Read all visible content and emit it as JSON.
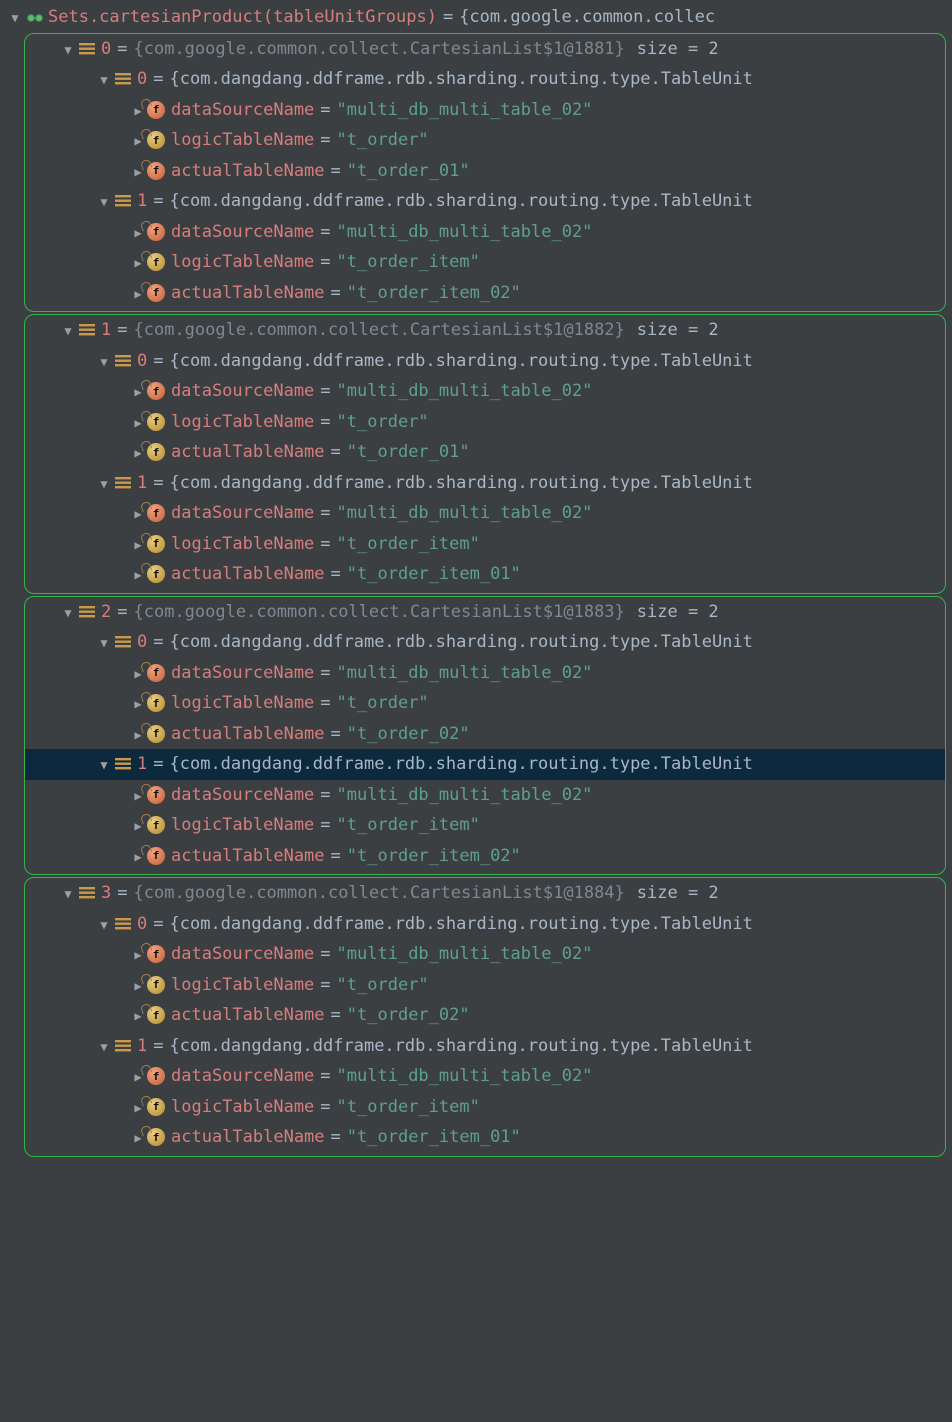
{
  "root": {
    "label": "Sets.cartesianProduct(tableUnitGroups)",
    "eq": "=",
    "value": "{com.google.common.collec"
  },
  "groups": [
    {
      "idx": "0",
      "brace": "{com.google.common.collect.CartesianList$1@1881}",
      "sizelabel": "size = 2",
      "units": [
        {
          "idx": "0",
          "brace": "{com.dangdang.ddframe.rdb.sharding.routing.type.TableUnit",
          "fields": [
            {
              "name": "dataSourceName",
              "val": "\"multi_db_multi_table_02\"",
              "color": "red"
            },
            {
              "name": "logicTableName",
              "val": "\"t_order\"",
              "color": "yel"
            },
            {
              "name": "actualTableName",
              "val": "\"t_order_01\"",
              "color": "red"
            }
          ]
        },
        {
          "idx": "1",
          "brace": "{com.dangdang.ddframe.rdb.sharding.routing.type.TableUnit",
          "fields": [
            {
              "name": "dataSourceName",
              "val": "\"multi_db_multi_table_02\"",
              "color": "red"
            },
            {
              "name": "logicTableName",
              "val": "\"t_order_item\"",
              "color": "yel"
            },
            {
              "name": "actualTableName",
              "val": "\"t_order_item_02\"",
              "color": "red"
            }
          ]
        }
      ]
    },
    {
      "idx": "1",
      "brace": "{com.google.common.collect.CartesianList$1@1882}",
      "sizelabel": "size = 2",
      "units": [
        {
          "idx": "0",
          "brace": "{com.dangdang.ddframe.rdb.sharding.routing.type.TableUnit",
          "fields": [
            {
              "name": "dataSourceName",
              "val": "\"multi_db_multi_table_02\"",
              "color": "red"
            },
            {
              "name": "logicTableName",
              "val": "\"t_order\"",
              "color": "yel"
            },
            {
              "name": "actualTableName",
              "val": "\"t_order_01\"",
              "color": "yel"
            }
          ]
        },
        {
          "idx": "1",
          "brace": "{com.dangdang.ddframe.rdb.sharding.routing.type.TableUnit",
          "fields": [
            {
              "name": "dataSourceName",
              "val": "\"multi_db_multi_table_02\"",
              "color": "red"
            },
            {
              "name": "logicTableName",
              "val": "\"t_order_item\"",
              "color": "yel"
            },
            {
              "name": "actualTableName",
              "val": "\"t_order_item_01\"",
              "color": "yel"
            }
          ]
        }
      ]
    },
    {
      "idx": "2",
      "brace": "{com.google.common.collect.CartesianList$1@1883}",
      "sizelabel": "size = 2",
      "units": [
        {
          "idx": "0",
          "brace": "{com.dangdang.ddframe.rdb.sharding.routing.type.TableUnit",
          "fields": [
            {
              "name": "dataSourceName",
              "val": "\"multi_db_multi_table_02\"",
              "color": "red"
            },
            {
              "name": "logicTableName",
              "val": "\"t_order\"",
              "color": "yel"
            },
            {
              "name": "actualTableName",
              "val": "\"t_order_02\"",
              "color": "yel"
            }
          ]
        },
        {
          "idx": "1",
          "selected": true,
          "brace": "{com.dangdang.ddframe.rdb.sharding.routing.type.TableUnit",
          "fields": [
            {
              "name": "dataSourceName",
              "val": "\"multi_db_multi_table_02\"",
              "color": "red"
            },
            {
              "name": "logicTableName",
              "val": "\"t_order_item\"",
              "color": "yel"
            },
            {
              "name": "actualTableName",
              "val": "\"t_order_item_02\"",
              "color": "red"
            }
          ]
        }
      ]
    },
    {
      "idx": "3",
      "brace": "{com.google.common.collect.CartesianList$1@1884}",
      "sizelabel": "size = 2",
      "units": [
        {
          "idx": "0",
          "brace": "{com.dangdang.ddframe.rdb.sharding.routing.type.TableUnit",
          "fields": [
            {
              "name": "dataSourceName",
              "val": "\"multi_db_multi_table_02\"",
              "color": "red"
            },
            {
              "name": "logicTableName",
              "val": "\"t_order\"",
              "color": "yel"
            },
            {
              "name": "actualTableName",
              "val": "\"t_order_02\"",
              "color": "yel"
            }
          ]
        },
        {
          "idx": "1",
          "brace": "{com.dangdang.ddframe.rdb.sharding.routing.type.TableUnit",
          "fields": [
            {
              "name": "dataSourceName",
              "val": "\"multi_db_multi_table_02\"",
              "color": "red"
            },
            {
              "name": "logicTableName",
              "val": "\"t_order_item\"",
              "color": "yel"
            },
            {
              "name": "actualTableName",
              "val": "\"t_order_item_01\"",
              "color": "yel"
            }
          ]
        }
      ]
    }
  ]
}
